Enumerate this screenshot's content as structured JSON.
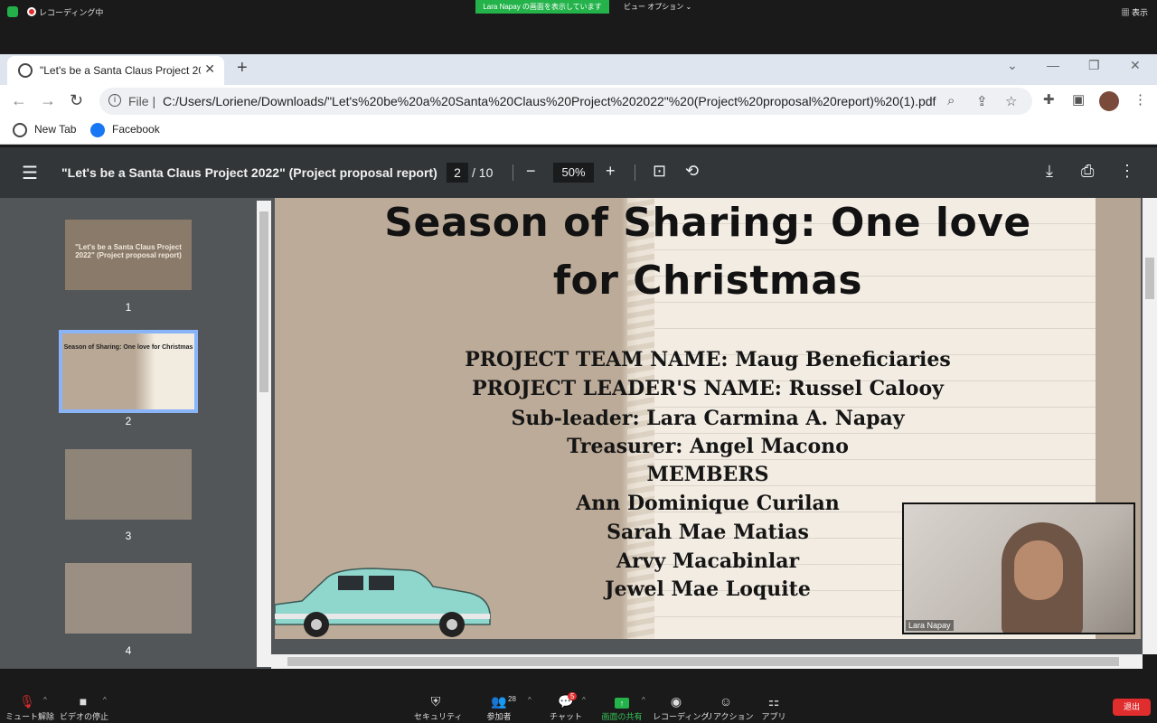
{
  "zoom_top": {
    "recording_label": "レコーディング中",
    "sharing_banner": "Lara  Napay の画面を表示しています",
    "view_options": "ビュー オプション ⌄",
    "show_label": "▦ 表示"
  },
  "browser": {
    "tab_title": "\"Let's be a Santa Claus Project 20",
    "file_label": "File |",
    "url": "C:/Users/Loriene/Downloads/\"Let's%20be%20a%20Santa%20Claus%20Project%202022\"%20(Project%20proposal%20report)%20(1).pdf",
    "bookmarks": [
      "New Tab",
      "Facebook"
    ]
  },
  "pdf": {
    "title": "\"Let's be a Santa Claus Project 2022\" (Project proposal report)",
    "current_page": "2",
    "page_total": "/  10",
    "zoom": "50%"
  },
  "thumbnails": [
    {
      "num": "1",
      "text": "\"Let's be a Santa Claus Project 2022\" (Project proposal report)"
    },
    {
      "num": "2",
      "text": "Season of Sharing: One love for Christmas"
    },
    {
      "num": "3",
      "text": ""
    },
    {
      "num": "4",
      "text": ""
    }
  ],
  "page2": {
    "heading_line1": "Season of Sharing: One love",
    "heading_line2": "for Christmas",
    "lines": [
      "PROJECT TEAM NAME: Maug Beneficiaries",
      "PROJECT LEADER'S NAME: Russel Calooy",
      "Sub-leader: Lara Carmina A. Napay",
      "Treasurer: Angel Macono",
      "MEMBERS",
      "Ann Dominique Curilan",
      "Sarah Mae Matias",
      "Arvy Macabinlar",
      "Jewel Mae Loquite"
    ]
  },
  "camera": {
    "name": "Lara Napay"
  },
  "zoom_bottom": {
    "unmute": "ミュート解除",
    "stop_video": "ビデオの停止",
    "security": "セキュリティ",
    "participants": "参加者",
    "participants_count": "28",
    "chat": "チャット",
    "chat_badge": "5",
    "share": "画面の共有",
    "recording": "レコーディング",
    "reactions": "リアクション",
    "apps": "アプリ",
    "leave": "退出"
  }
}
